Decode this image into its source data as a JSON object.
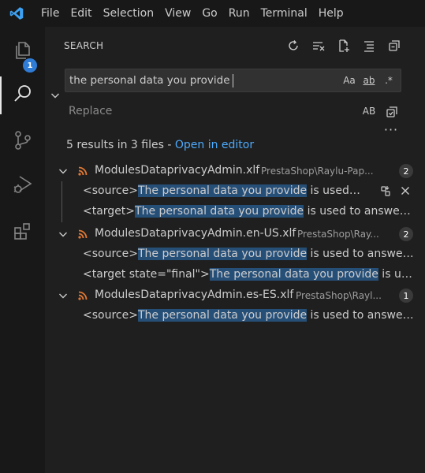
{
  "menu": [
    "File",
    "Edit",
    "Selection",
    "View",
    "Go",
    "Run",
    "Terminal",
    "Help"
  ],
  "activity": {
    "explorer_badge": "1"
  },
  "sidebar": {
    "title": "SEARCH"
  },
  "search": {
    "value": "the personal data you provide",
    "opt_case": "Aa",
    "opt_word": "ab",
    "opt_regex": ".*"
  },
  "replace": {
    "placeholder": "Replace",
    "opt_preserve_case": "AB"
  },
  "summary": {
    "text": "5 results in 3 files - ",
    "link": "Open in editor"
  },
  "files": [
    {
      "name": "ModulesDataprivacyAdmin.xlf",
      "path": "PrestaShop\\Raylu-Pap...",
      "count": "2",
      "matches": [
        {
          "before": "<source>",
          "match": "The personal data you provide",
          "after": " is used ..."
        },
        {
          "before": "<target>",
          "match": "The personal data you provide",
          "after": " is used to answer q..."
        }
      ]
    },
    {
      "name": "ModulesDataprivacyAdmin.en-US.xlf",
      "path": "PrestaShop\\Ray...",
      "count": "2",
      "matches": [
        {
          "before": "<source>",
          "match": "The personal data you provide",
          "after": " is used to answer ..."
        },
        {
          "before": "<target state=\"final\">",
          "match": "The personal data you provide",
          "after": " is use..."
        }
      ]
    },
    {
      "name": "ModulesDataprivacyAdmin.es-ES.xlf",
      "path": "PrestaShop\\Rayl...",
      "count": "1",
      "matches": [
        {
          "before": "<source>",
          "match": "The personal data you provide",
          "after": " is used to answer ..."
        }
      ]
    }
  ],
  "colors": {
    "accent": "#2f7cd6",
    "link": "#4daafc",
    "match_highlight": "#264f78",
    "xml_icon": "#e37933",
    "vscode_logo": "#3ea1f2"
  }
}
